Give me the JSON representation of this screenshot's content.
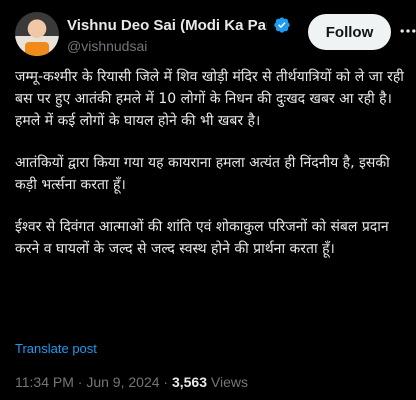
{
  "author": {
    "display_name": "Vishnu Deo Sai (Modi Ka Par",
    "handle": "@vishnudsai",
    "verified": true
  },
  "follow_label": "Follow",
  "tweet": {
    "paragraphs": [
      "जम्मू-कश्मीर के रियासी जिले में शिव खोड़ी मंदिर से तीर्थयात्रियों को ले जा रही बस पर हुए आतंकी हमले में 10 लोगों के निधन की दुःखद खबर आ रही है। हमले में कई लोगों के घायल होने की भी खबर है।",
      "आतंकियों द्वारा किया गया यह कायराना हमला अत्यंत ही निंदनीय है, इसकी कड़ी भर्त्सना करता हूँ।",
      "ईश्वर से दिवंगत आत्माओं की शांति एवं शोकाकुल परिजनों को संबल प्रदान करने व घायलों के जल्द से जल्द स्वस्थ होने की प्रार्थना करता हूँ।"
    ]
  },
  "translate_label": "Translate post",
  "meta": {
    "time": "11:34 PM",
    "separator": "·",
    "date": "Jun 9, 2024",
    "views_count": "3,563",
    "views_label": "Views"
  },
  "colors": {
    "background": "#000000",
    "text": "#e7e9ea",
    "muted": "#71767b",
    "link": "#1d9bf0",
    "verified": "#1d9bf0"
  },
  "icons": {
    "verified": "verified-badge-icon",
    "more": "more-options-icon"
  }
}
